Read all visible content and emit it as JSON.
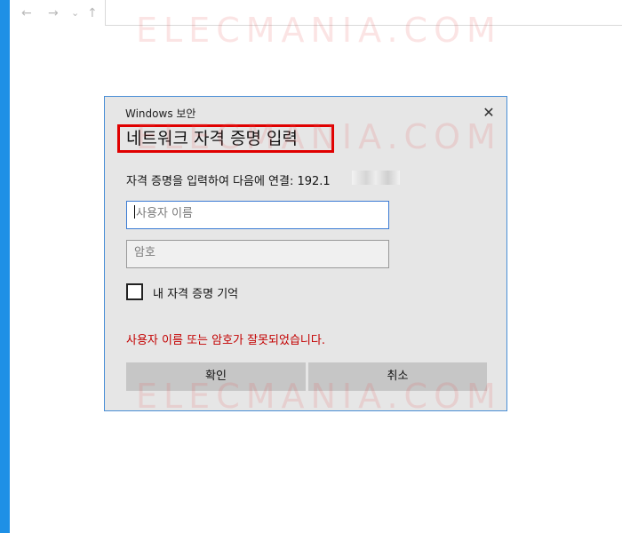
{
  "browser": {
    "back_icon": "←",
    "forward_icon": "→",
    "dropdown_icon": "⌄",
    "up_icon": "↑"
  },
  "watermark": "ELECMANIA.COM",
  "dialog": {
    "window_title": "Windows 보안",
    "close_icon": "✕",
    "heading": "네트워크 자격 증명 입력",
    "description": "자격 증명을 입력하여 다음에 연결: 192.1",
    "username_placeholder": "사용자 이름",
    "password_placeholder": "암호",
    "remember_label": "내 자격 증명 기억",
    "error_message": "사용자 이름 또는 암호가 잘못되었습니다.",
    "ok_label": "확인",
    "cancel_label": "취소"
  },
  "colors": {
    "accent": "#1e90e6",
    "dialog_border": "#4a8fd6",
    "highlight_box": "#e00000",
    "error_text": "#c30000",
    "button": "#c6c6c6"
  }
}
